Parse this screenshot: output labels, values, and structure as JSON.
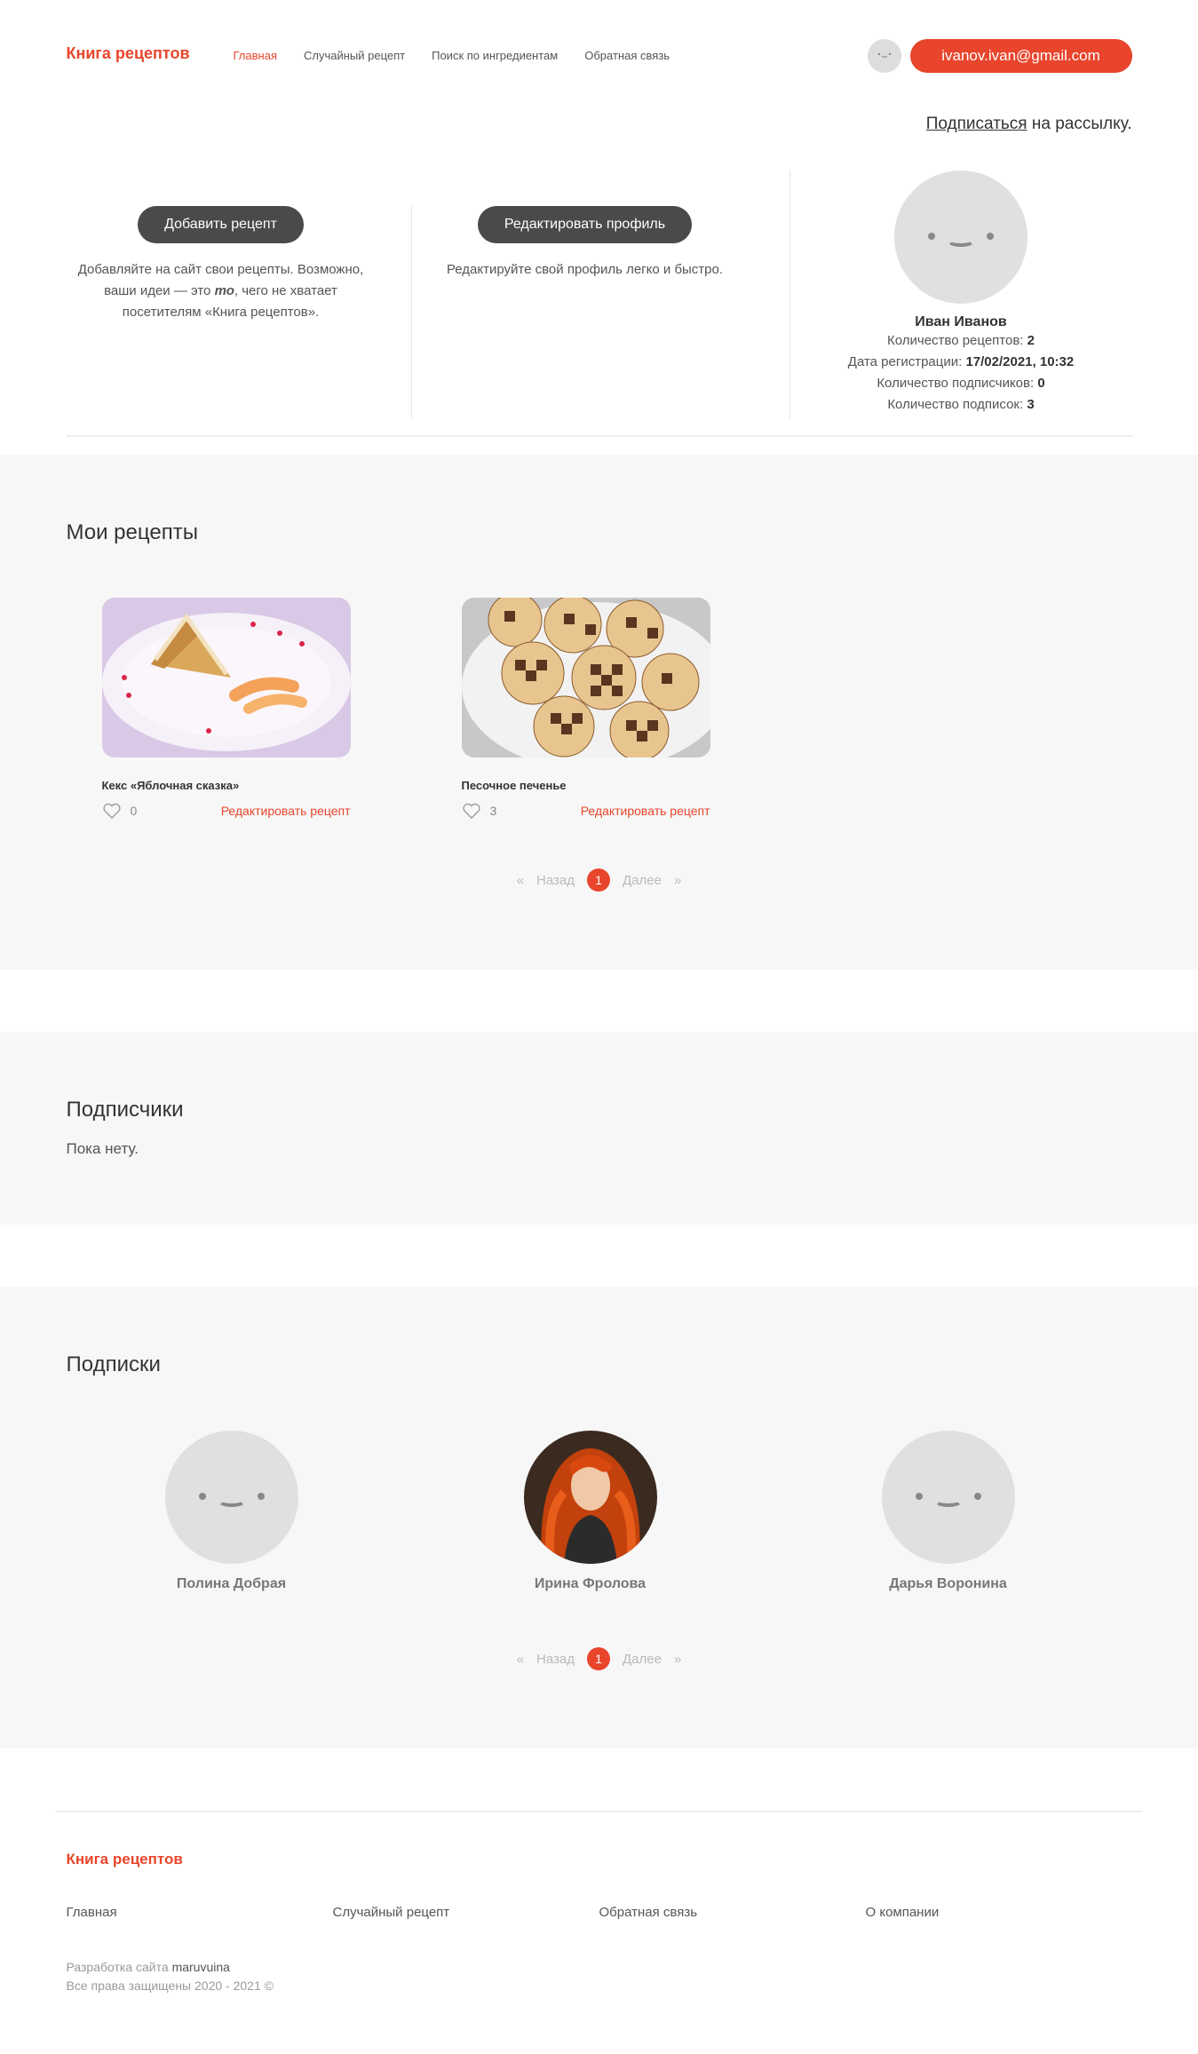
{
  "header": {
    "logo": "Книга рецептов",
    "nav": [
      "Главная",
      "Случайный рецепт",
      "Поиск по ингредиентам",
      "Обратная связь"
    ],
    "email": "ivanov.ivan@gmail.com",
    "subscribe_link": "Подписаться",
    "subscribe_rest": " на рассылку."
  },
  "profile": {
    "add_button": "Добавить рецепт",
    "add_desc_1": "Добавляйте на сайт свои рецепты. Возможно,",
    "add_desc_2a": "ваши идеи — это ",
    "add_desc_2b": "то",
    "add_desc_2c": ", чего не хватает",
    "add_desc_3": "посетителям «Книга рецептов».",
    "edit_button": "Редактировать профиль",
    "edit_desc": "Редактируйте свой профиль легко и быстро.",
    "name": "Иван Иванов",
    "recipes_label": "Количество рецептов: ",
    "recipes_value": "2",
    "reg_label": "Дата регистрации: ",
    "reg_value": "17/02/2021, 10:32",
    "subscribers_label": "Количество подписчиков: ",
    "subscribers_value": "0",
    "subscriptions_label": "Количество подписок: ",
    "subscriptions_value": "3"
  },
  "my_recipes": {
    "title": "Мои рецепты",
    "items": [
      {
        "title": "Кекс «Яблочная сказка»",
        "likes": "0",
        "edit": "Редактировать рецепт"
      },
      {
        "title": "Песочное печенье",
        "likes": "3",
        "edit": "Редактировать рецепт"
      }
    ]
  },
  "pager": {
    "prev": "Назад",
    "current": "1",
    "next": "Далее",
    "laquo": "«",
    "raquo": "»"
  },
  "subscribers": {
    "title": "Подписчики",
    "empty": "Пока нету."
  },
  "subscriptions": {
    "title": "Подписки",
    "people": [
      "Полина Добрая",
      "Ирина Фролова",
      "Дарья Воронина"
    ]
  },
  "footer": {
    "logo": "Книга рецептов",
    "nav": [
      "Главная",
      "Случайный рецепт",
      "Обратная связь",
      "О компании"
    ],
    "dev_label": "Разработка сайта ",
    "dev_author": "maruvuina",
    "rights": "Все права защищены 2020 - 2021 ©"
  },
  "colors": {
    "accent": "#e8452c",
    "dark_button": "#4a4a4a",
    "section_bg": "#f7f7f7"
  }
}
